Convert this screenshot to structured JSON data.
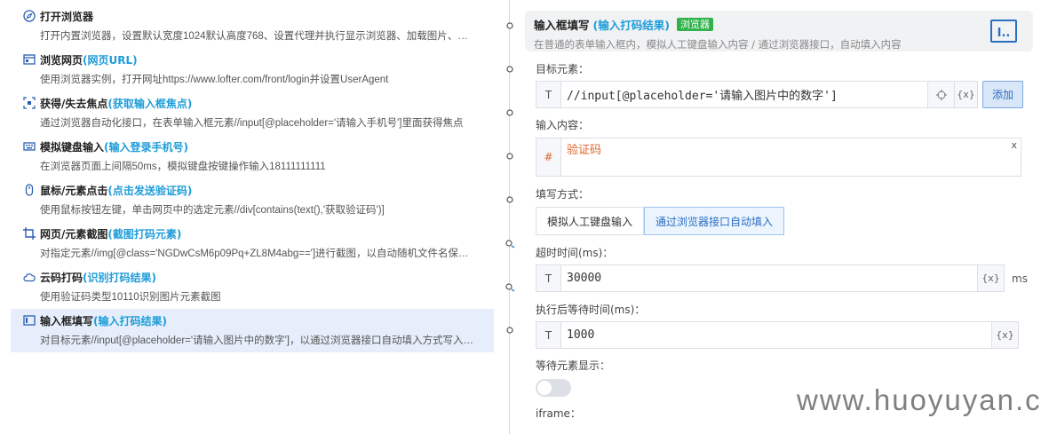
{
  "steps": [
    {
      "icon": "compass-icon",
      "title": "打开浏览器",
      "highlight": "",
      "desc": "打开内置浏览器，设置默认宽度1024默认高度768、设置代理并执行显示浏览器、加载图片、…"
    },
    {
      "icon": "browser-window-icon",
      "title": "浏览网页",
      "highlight": "(网页URL)",
      "desc": "使用浏览器实例，打开网址https://www.lofter.com/front/login并设置UserAgent"
    },
    {
      "icon": "focus-icon",
      "title": "获得/失去焦点",
      "highlight": "(获取输入框焦点)",
      "desc": "通过浏览器自动化接口，在表单输入框元素//input[@placeholder='请输入手机号']里面获得焦点"
    },
    {
      "icon": "keyboard-icon",
      "title": "模拟键盘输入",
      "highlight": "(输入登录手机号)",
      "desc": "在浏览器页面上间隔50ms，模拟键盘按键操作输入18111111111"
    },
    {
      "icon": "mouse-icon",
      "title": "鼠标/元素点击",
      "highlight": "(点击发送验证码)",
      "desc": "使用鼠标按钮左键，单击网页中的选定元素//div[contains(text(),'获取验证码')]"
    },
    {
      "icon": "crop-icon",
      "title": "网页/元素截图",
      "highlight": "(截图打码元素)",
      "desc": "对指定元素//img[@class='NGDwCsM6p09Pq+ZL8M4abg==']进行截图，以自动随机文件名保…"
    },
    {
      "icon": "cloud-icon",
      "title": "云码打码",
      "highlight": "(识别打码结果)",
      "desc": "使用验证码类型10110识别图片元素截图"
    },
    {
      "icon": "input-box-icon",
      "title": "输入框填写",
      "highlight": "(输入打码结果)",
      "desc": "对目标元素//input[@placeholder='请输入图片中的数字']，以通过浏览器接口自动填入方式写入…"
    }
  ],
  "panel": {
    "title": "输入框填写",
    "title_highlight": "(输入打码结果)",
    "badge": "浏览器",
    "desc": "在普通的表单输入框内，模拟人工键盘输入内容 / 通过浏览器接口，自动填入内容",
    "header_icon_text": "I..",
    "target_label": "目标元素：",
    "target_prefix": "T",
    "target_value": "//input[@placeholder='请输入图片中的数字']",
    "target_var": "{x}",
    "add_label": "添加",
    "content_label": "输入内容：",
    "content_prefix": "#",
    "content_value": "验证码",
    "content_clear": "x",
    "mode_label": "填写方式：",
    "modes": [
      "模拟人工键盘输入",
      "通过浏览器接口自动填入"
    ],
    "mode_selected": 1,
    "timeout_label": "超时时间(ms)：",
    "timeout_prefix": "T",
    "timeout_value": "30000",
    "timeout_var": "{x}",
    "timeout_unit": "ms",
    "wait_label": "执行后等待时间(ms)：",
    "wait_prefix": "T",
    "wait_value": "1000",
    "wait_var": "{x}",
    "wait_elem_label": "等待元素显示：",
    "wait_elem_enabled": false,
    "iframe_label": "iframe："
  },
  "watermark": "www.huoyuyan.com"
}
